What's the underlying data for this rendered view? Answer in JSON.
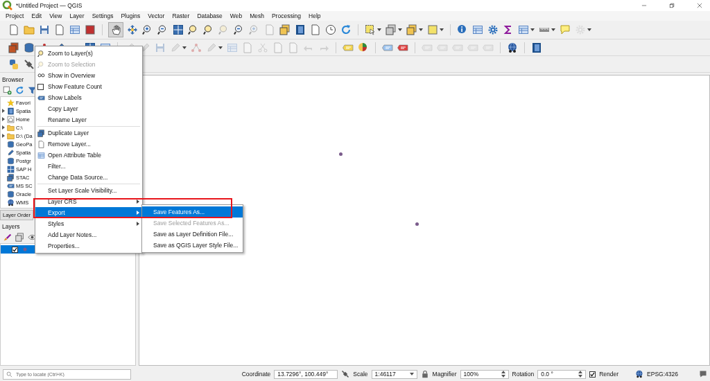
{
  "window": {
    "title": "*Untitled Project — QGIS"
  },
  "menu_bar": [
    "Project",
    "Edit",
    "View",
    "Layer",
    "Settings",
    "Plugins",
    "Vector",
    "Raster",
    "Database",
    "Web",
    "Mesh",
    "Processing",
    "Help"
  ],
  "browser_panel": {
    "title": "Browser",
    "items": [
      {
        "label": "Favori"
      },
      {
        "label": "Spatia",
        "expanded": false
      },
      {
        "label": "Home",
        "expanded": false
      },
      {
        "label": "C:\\",
        "expanded": false
      },
      {
        "label": "D:\\ (Da",
        "expanded": false
      },
      {
        "label": "GeoPa"
      },
      {
        "label": "Spatia"
      },
      {
        "label": "Postgr"
      },
      {
        "label": "SAP H"
      },
      {
        "label": "STAC"
      },
      {
        "label": "MS SC"
      },
      {
        "label": "Oracle"
      },
      {
        "label": "WMS"
      }
    ]
  },
  "panel_tabs": [
    {
      "label": "Layer Order",
      "selected": false
    }
  ],
  "layers_panel": {
    "title": "Layers",
    "layers": [
      {
        "checked": true,
        "selected": true
      }
    ]
  },
  "context_menu": {
    "groups": [
      [
        {
          "label": "Zoom to Layer(s)",
          "disabled": false,
          "selected": false
        },
        {
          "label": "Zoom to Selection",
          "disabled": true,
          "selected": false
        },
        {
          "label": "Show in Overview",
          "disabled": false,
          "selected": false
        },
        {
          "label": "Show Feature Count",
          "disabled": false,
          "selected": false,
          "checked": false
        },
        {
          "label": "Show Labels",
          "disabled": false,
          "selected": false
        },
        {
          "label": "Copy Layer",
          "disabled": false,
          "selected": false
        },
        {
          "label": "Rename Layer",
          "disabled": false,
          "selected": false
        }
      ],
      [
        {
          "label": "Duplicate Layer",
          "disabled": false,
          "selected": false
        },
        {
          "label": "Remove Layer...",
          "disabled": false,
          "selected": false
        },
        {
          "label": "Open Attribute Table",
          "disabled": false,
          "selected": false
        },
        {
          "label": "Filter...",
          "disabled": false,
          "selected": false
        },
        {
          "label": "Change Data Source...",
          "disabled": false,
          "selected": false
        }
      ],
      [
        {
          "label": "Set Layer Scale Visibility...",
          "disabled": false,
          "selected": false
        },
        {
          "label": "Layer CRS",
          "disabled": false,
          "selected": false,
          "submenu": true
        },
        {
          "label": "Export",
          "disabled": false,
          "selected": true,
          "submenu": true
        },
        {
          "label": "Styles",
          "disabled": false,
          "selected": false,
          "submenu": true
        },
        {
          "label": "Add Layer Notes...",
          "disabled": false,
          "selected": false
        },
        {
          "label": "Properties...",
          "disabled": false,
          "selected": false
        }
      ]
    ]
  },
  "export_submenu": {
    "items": [
      {
        "label": "Save Features As...",
        "disabled": false,
        "selected": true
      },
      {
        "label": "Save Selected Features As...",
        "disabled": true,
        "selected": false
      },
      {
        "label": "Save as Layer Definition File...",
        "disabled": false,
        "selected": false
      },
      {
        "label": "Save as QGIS Layer Style File...",
        "disabled": false,
        "selected": false
      }
    ]
  },
  "status_bar": {
    "locate_placeholder": "Type to locate (Ctrl+K)",
    "coordinate_label": "Coordinate",
    "coordinate": "13.7296°, 100.449°",
    "scale_label": "Scale",
    "scale": "1:46117",
    "magnifier_label": "Magnifier",
    "magnifier": "100%",
    "rotation_label": "Rotation",
    "rotation": "0.0 °",
    "render": {
      "label": "Render",
      "checked": true
    },
    "crs": "EPSG:4326"
  }
}
